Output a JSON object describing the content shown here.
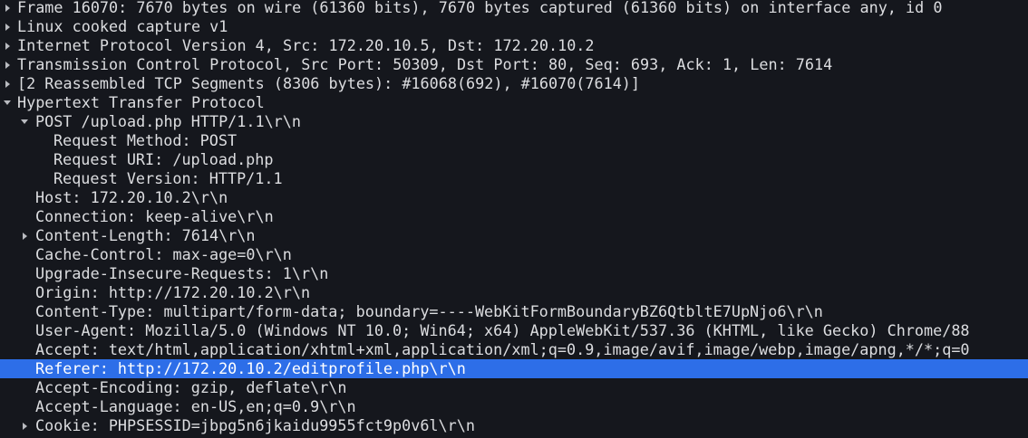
{
  "packet_details": {
    "frame": "Frame 16070: 7670 bytes on wire (61360 bits), 7670 bytes captured (61360 bits) on interface any, id 0",
    "linux_cooked": "Linux cooked capture v1",
    "ip": "Internet Protocol Version 4, Src: 172.20.10.5, Dst: 172.20.10.2",
    "tcp": "Transmission Control Protocol, Src Port: 50309, Dst Port: 80, Seq: 693, Ack: 1, Len: 7614",
    "reassembled": "[2 Reassembled TCP Segments (8306 bytes): #16068(692), #16070(7614)]",
    "http": {
      "title": "Hypertext Transfer Protocol",
      "request_line": "POST /upload.php HTTP/1.1\\r\\n",
      "request_method": "Request Method: POST",
      "request_uri": "Request URI: /upload.php",
      "request_version": "Request Version: HTTP/1.1",
      "host": "Host: 172.20.10.2\\r\\n",
      "connection": "Connection: keep-alive\\r\\n",
      "content_length": "Content-Length: 7614\\r\\n",
      "cache_control": "Cache-Control: max-age=0\\r\\n",
      "upgrade_insecure": "Upgrade-Insecure-Requests: 1\\r\\n",
      "origin": "Origin: http://172.20.10.2\\r\\n",
      "content_type": "Content-Type: multipart/form-data; boundary=----WebKitFormBoundaryBZ6QtbltE7UpNjo6\\r\\n",
      "user_agent": "User-Agent: Mozilla/5.0 (Windows NT 10.0; Win64; x64) AppleWebKit/537.36 (KHTML, like Gecko) Chrome/88",
      "accept": "Accept: text/html,application/xhtml+xml,application/xml;q=0.9,image/avif,image/webp,image/apng,*/*;q=0",
      "referer": "Referer: http://172.20.10.2/editprofile.php\\r\\n",
      "accept_encoding": "Accept-Encoding: gzip, deflate\\r\\n",
      "accept_language": "Accept-Language: en-US,en;q=0.9\\r\\n",
      "cookie": "Cookie: PHPSESSID=jbpg5n6jkaidu9955fct9p0v6l\\r\\n"
    }
  },
  "icons": {
    "collapsed": "chevron-right-icon",
    "expanded": "chevron-down-icon"
  },
  "colors": {
    "background": "#15171d",
    "text": "#dcdde0",
    "selection": "#2d6ee8",
    "arrow": "#b9bbc0"
  }
}
